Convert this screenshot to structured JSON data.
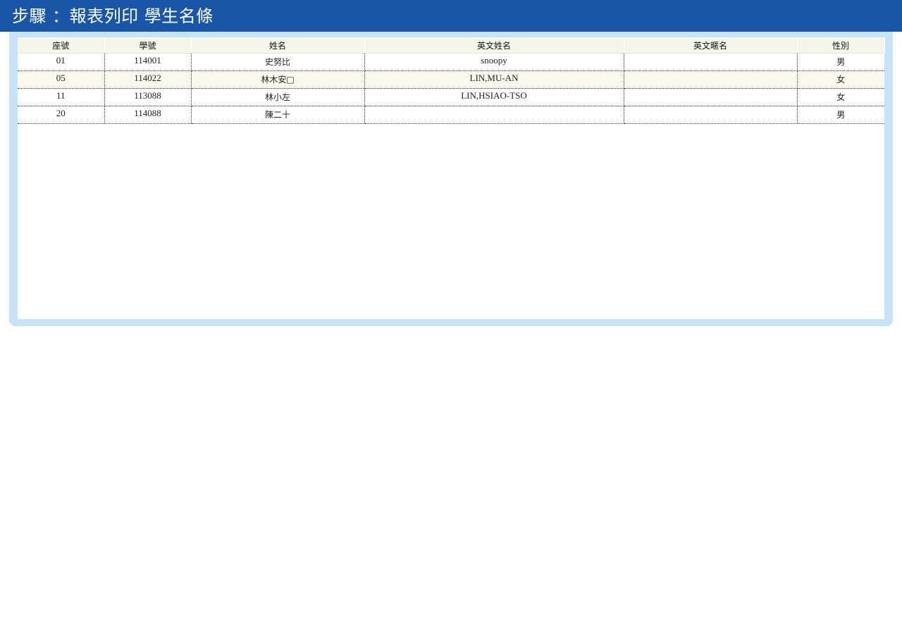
{
  "header": {
    "title": "步驟 ：報表列印  學生名條"
  },
  "table": {
    "columns": [
      "座號",
      "學號",
      "姓名",
      "英文姓名",
      "英文暱名",
      "性別"
    ],
    "rows": [
      {
        "seat": "01",
        "student_id": "114001",
        "name": "史努比",
        "english_name": "snoopy",
        "english_nickname": "",
        "gender": "男"
      },
      {
        "seat": "05",
        "student_id": "114022",
        "name": "林木安□",
        "english_name": "LIN,MU-AN",
        "english_nickname": "",
        "gender": "女"
      },
      {
        "seat": "11",
        "student_id": "113088",
        "name": "林小左",
        "english_name": "LIN,HSIAO-TSO",
        "english_nickname": "",
        "gender": "女"
      },
      {
        "seat": "20",
        "student_id": "114088",
        "name": "陳二十",
        "english_name": "",
        "english_nickname": "",
        "gender": "男"
      }
    ]
  },
  "colors": {
    "header_bg": "#1a56a8",
    "frame_bg": "#c7e3fa",
    "table_header_bg": "#f5f5ea",
    "row_alt_bg": "#fbf8ee"
  }
}
